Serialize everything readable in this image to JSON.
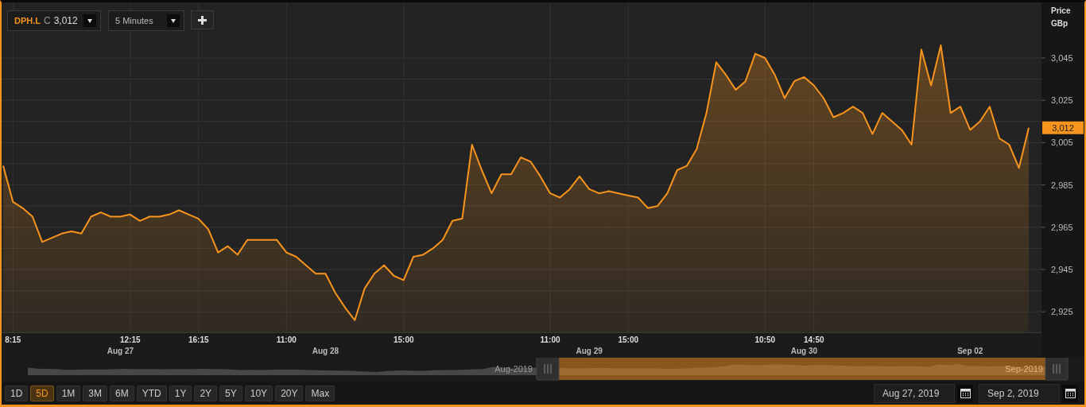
{
  "instrument": {
    "symbol": "DPH.L",
    "prefix": "C",
    "price": "3,012"
  },
  "interval": {
    "value": "5 Minutes"
  },
  "price_axis": {
    "title": "Price",
    "unit": "GBp",
    "current_price": "3,012"
  },
  "chart": {
    "chart_data": {
      "type": "area",
      "categories": [
        null,
        "8:15",
        null,
        null,
        null,
        null,
        null,
        null,
        null,
        null,
        null,
        null,
        null,
        "12:15",
        null,
        null,
        null,
        null,
        null,
        null,
        "16:15",
        null,
        null,
        null,
        null,
        null,
        null,
        null,
        null,
        "11:00",
        null,
        null,
        null,
        null,
        null,
        null,
        null,
        null,
        null,
        null,
        null,
        "15:00",
        null,
        null,
        null,
        null,
        null,
        null,
        null,
        null,
        null,
        null,
        null,
        null,
        null,
        null,
        "11:00",
        null,
        null,
        null,
        null,
        null,
        null,
        null,
        "15:00",
        null,
        null,
        null,
        null,
        null,
        null,
        null,
        null,
        null,
        null,
        null,
        null,
        null,
        "10:50",
        null,
        null,
        null,
        null,
        "14:50",
        null,
        null,
        null,
        null,
        null,
        null,
        null,
        null,
        null,
        null,
        null,
        null,
        null,
        null,
        null,
        null,
        null,
        null,
        null,
        null,
        null,
        null
      ],
      "series": [
        {
          "color": "#f7941d",
          "values": [
            2994,
            2977,
            2974,
            2970,
            2958,
            2960,
            2962,
            2963,
            2962,
            2970,
            2972,
            2970,
            2970,
            2971,
            2968,
            2970,
            2970,
            2971,
            2973,
            2971,
            2969,
            2964,
            2953,
            2956,
            2952,
            2959,
            2959,
            2959,
            2959,
            2953,
            2951,
            2947,
            2943,
            2943,
            2934,
            2927,
            2921,
            2936,
            2943,
            2947,
            2942,
            2940,
            2951,
            2952,
            2955,
            2959,
            2968,
            2969,
            3004,
            2992,
            2981,
            2990,
            2990,
            2998,
            2996,
            2989,
            2981,
            2979,
            2983,
            2989,
            2983,
            2981,
            2982,
            2981,
            2980,
            2979,
            2974,
            2975,
            2981,
            2992,
            2994,
            3002,
            3019,
            3043,
            3037,
            3030,
            3034,
            3047,
            3045,
            3037,
            3026,
            3034,
            3036,
            3032,
            3026,
            3017,
            3019,
            3022,
            3019,
            3009,
            3019,
            3015,
            3011,
            3004,
            3049,
            3032,
            3051,
            3019,
            3022,
            3011,
            3015,
            3022,
            3007,
            3004,
            2993,
            3012
          ]
        }
      ],
      "ylim": [
        2915.3,
        3071.3
      ],
      "grid": true,
      "yticks": [
        {
          "value": 2925,
          "label": "2,925"
        },
        {
          "value": 2945,
          "label": "2,945"
        },
        {
          "value": 2965,
          "label": "2,965"
        },
        {
          "value": 2985,
          "label": "2,985"
        },
        {
          "value": 3005,
          "label": "3,005"
        },
        {
          "value": 3025,
          "label": "3,025"
        },
        {
          "value": 3045,
          "label": "3,045"
        }
      ]
    },
    "date_labels": [
      "Aug 27",
      "Aug 28",
      "Aug 29",
      "Aug 30",
      "Sep 02"
    ]
  },
  "navigator": {
    "start_label": "Aug-2019",
    "end_label": "Sep-2019"
  },
  "range_buttons": [
    {
      "label": "1D",
      "selected": false
    },
    {
      "label": "5D",
      "selected": true
    },
    {
      "label": "1M",
      "selected": false
    },
    {
      "label": "3M",
      "selected": false
    },
    {
      "label": "6M",
      "selected": false
    },
    {
      "label": "YTD",
      "selected": false
    },
    {
      "label": "1Y",
      "selected": false
    },
    {
      "label": "2Y",
      "selected": false
    },
    {
      "label": "5Y",
      "selected": false
    },
    {
      "label": "10Y",
      "selected": false
    },
    {
      "label": "20Y",
      "selected": false
    },
    {
      "label": "Max",
      "selected": false
    }
  ],
  "date_range": {
    "from": "Aug 27, 2019",
    "to": "Sep 2, 2019"
  }
}
